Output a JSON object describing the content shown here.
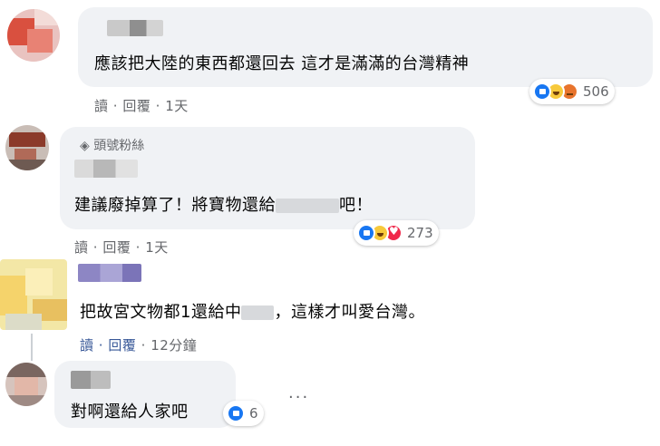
{
  "comments": [
    {
      "id": "c1",
      "text": "應該把大陸的東西都還回去 這才是滿滿的台灣精神",
      "actions": {
        "read": "讀",
        "sep": "·",
        "reply": "回覆",
        "time": "1天"
      },
      "reactions": {
        "types": [
          "like",
          "haha",
          "angry"
        ],
        "count": "506"
      }
    },
    {
      "id": "c2",
      "badge": "頭號粉絲",
      "badge_icon": "diamond-icon",
      "text_before": "建議廢掉算了！將寶物還給",
      "text_after": "吧！",
      "actions": {
        "read": "讀",
        "sep": "·",
        "reply": "回覆",
        "time": "1天"
      },
      "reactions": {
        "types": [
          "like",
          "haha",
          "love"
        ],
        "count": "273"
      }
    },
    {
      "id": "c3",
      "text_before": "把故宮文物都1還給中",
      "text_after": "，這樣才叫愛台灣。",
      "actions": {
        "read": "讀",
        "sep": "·",
        "reply": "回覆",
        "time": "12分鐘"
      }
    },
    {
      "id": "c4",
      "text": "對啊還給人家吧",
      "reactions": {
        "types": [
          "like"
        ],
        "count": "6"
      },
      "more": "···"
    }
  ],
  "colors": {
    "bubble": "#f0f2f5",
    "link": "#385898",
    "meta": "#65676b",
    "like": "#1877f2"
  }
}
